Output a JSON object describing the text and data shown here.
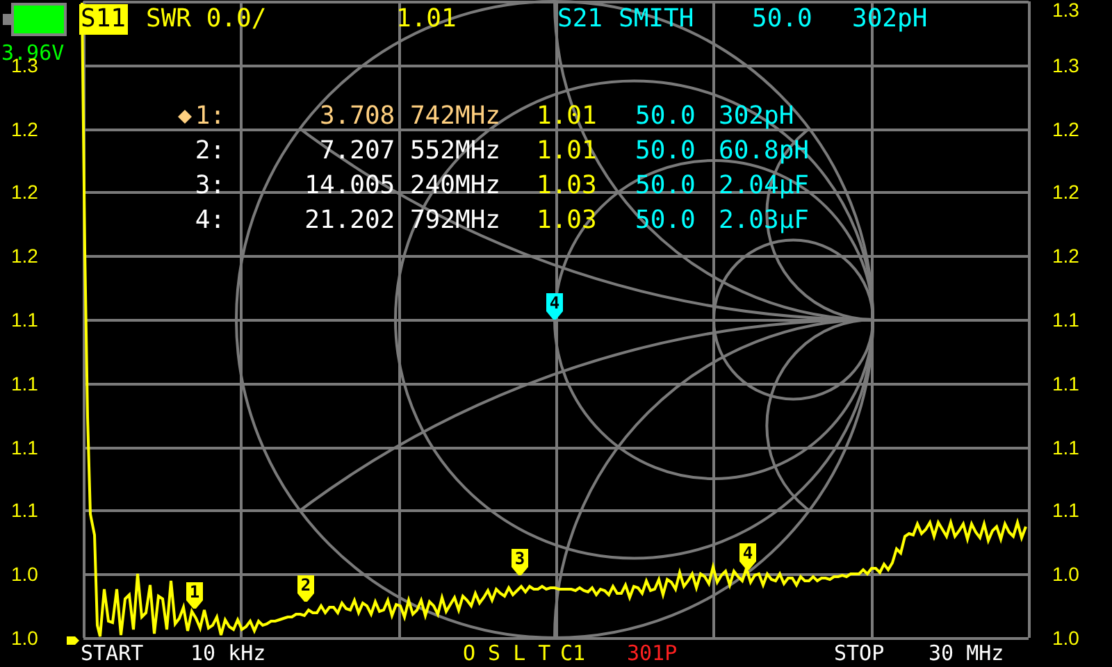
{
  "battery": {
    "voltage": "3.96V"
  },
  "traces": [
    {
      "channel": "S11",
      "format": "SWR 0.0/",
      "values": [
        "1.01"
      ],
      "color": "#ffff00",
      "selected": true
    },
    {
      "channel": "S21",
      "format": "SMITH",
      "values": [
        "50.0",
        "302pH"
      ],
      "color": "#00ffff",
      "selected": false
    }
  ],
  "markers": [
    {
      "label": "1:",
      "frequency": "3.708 742MHz",
      "swr": "1.01",
      "resistance": "50.0",
      "reactance": "302pH",
      "selected": true
    },
    {
      "label": "2:",
      "frequency": "7.207 552MHz",
      "swr": "1.01",
      "resistance": "50.0",
      "reactance": "60.8pH",
      "selected": false
    },
    {
      "label": "3:",
      "frequency": "14.005 240MHz",
      "swr": "1.03",
      "resistance": "50.0",
      "reactance": "2.04µF",
      "selected": false
    },
    {
      "label": "4:",
      "frequency": "21.202 792MHz",
      "swr": "1.03",
      "resistance": "50.0",
      "reactance": "2.03µF",
      "selected": false
    }
  ],
  "trace_markers": [
    {
      "label": "1"
    },
    {
      "label": "2"
    },
    {
      "label": "3"
    },
    {
      "label": "4"
    }
  ],
  "smith_markers": [
    {
      "label": "4"
    }
  ],
  "left_scale": [
    "1.3",
    "1.2",
    "1.2",
    "1.2",
    "1.1",
    "1.1",
    "1.1",
    "1.1",
    "1.0",
    "1.0"
  ],
  "right_scale": [
    "1.3",
    "1.3",
    "1.2",
    "1.2",
    "1.2",
    "1.1",
    "1.1",
    "1.1",
    "1.1",
    "1.0",
    "1.0"
  ],
  "status_bar": {
    "start_label": "START",
    "start": "10 kHz",
    "calibration": "O S L T",
    "cal_set": "C1",
    "points": "301P",
    "stop_label": "STOP",
    "stop": "30 MHz"
  }
}
